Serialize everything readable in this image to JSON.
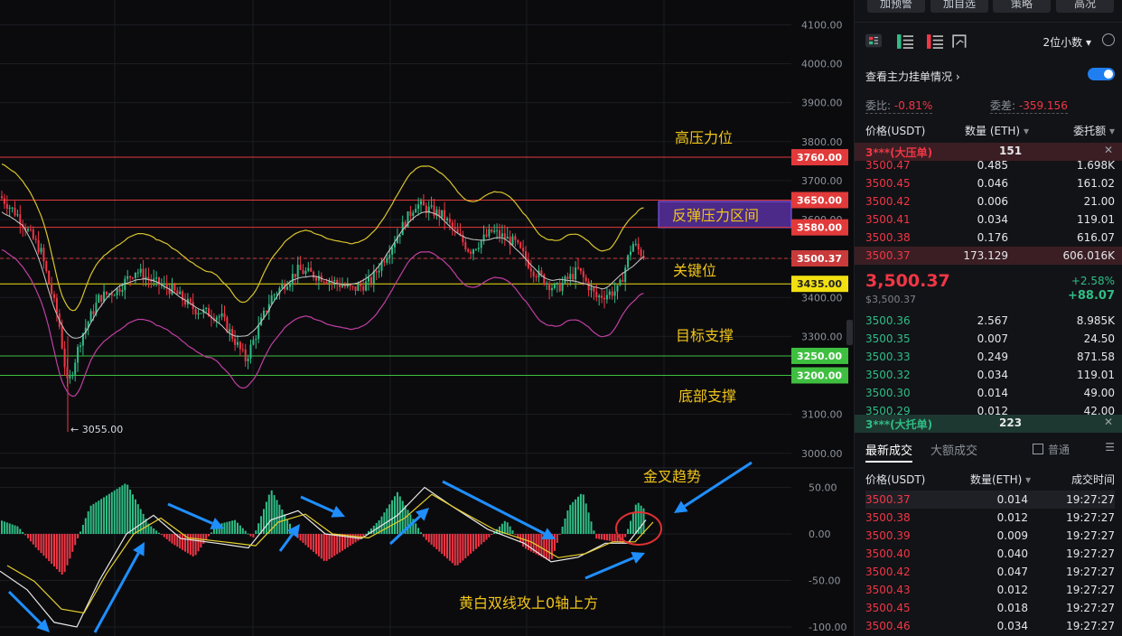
{
  "price_axis": {
    "main_ticks": [
      "4100.00",
      "4000.00",
      "3900.00",
      "3800.00",
      "3700.00",
      "3600.00",
      "3500.00",
      "3400.00",
      "3300.00",
      "3200.00",
      "3100.00",
      "3000.00"
    ],
    "macd_ticks": [
      "50.00",
      "0.00",
      "-50.00",
      "-100.00"
    ]
  },
  "levels": [
    {
      "label": "3760.00",
      "color": "#e23a3a"
    },
    {
      "label": "3650.00",
      "color": "#e23a3a"
    },
    {
      "label": "3580.00",
      "color": "#e23a3a"
    },
    {
      "label": "3500.37",
      "color": "#c93a3a"
    },
    {
      "label": "3435.00",
      "color": "#f2e011"
    },
    {
      "label": "3250.00",
      "color": "#3fbf3f"
    },
    {
      "label": "3200.00",
      "color": "#3fbf3f"
    }
  ],
  "annotations": {
    "high_pressure": "高压力位",
    "rebound_zone": "反弹压力区间",
    "key_level": "关键位",
    "target_support": "目标支撑",
    "bottom_support": "底部支撑",
    "low_marker": "← 3055.00",
    "golden_cross": "金叉趋势",
    "macd_note": "黄白双线攻上0轴上方"
  },
  "colors": {
    "up": "#2fbd85",
    "down": "#f23645",
    "boll_upper": "#d8c32b",
    "boll_mid": "#c9c9c9",
    "boll_lower": "#c03fa0",
    "arrow": "#1f8fff"
  },
  "panel": {
    "top_buttons": [
      "加预警",
      "加自选",
      "策略",
      "高况"
    ],
    "decimal_select": "2位小数",
    "main_order_toggle_label": "查看主力挂单情况",
    "commission_ratio_label": "委比:",
    "commission_ratio_value": "-0.81%",
    "commission_diff_label": "委差:",
    "commission_diff_value": "-359.156",
    "col_price": "价格(USDT)",
    "col_qty": "数量 (ETH)",
    "col_amount": "委托额",
    "big_ask_label": "3***(大压单)",
    "big_ask_qty": "151",
    "asks": [
      {
        "price": "3500.47",
        "qty": "0.485",
        "amt": "1.698K"
      },
      {
        "price": "3500.45",
        "qty": "0.046",
        "amt": "161.02"
      },
      {
        "price": "3500.42",
        "qty": "0.006",
        "amt": "21.00"
      },
      {
        "price": "3500.41",
        "qty": "0.034",
        "amt": "119.01"
      },
      {
        "price": "3500.38",
        "qty": "0.176",
        "amt": "616.07"
      },
      {
        "price": "3500.37",
        "qty": "173.129",
        "amt": "606.016K"
      }
    ],
    "last_price": "3,500.37",
    "last_price_sub": "$3,500.37",
    "change_pct": "+2.58%",
    "change_abs": "+88.07",
    "bids": [
      {
        "price": "3500.36",
        "qty": "2.567",
        "amt": "8.985K"
      },
      {
        "price": "3500.35",
        "qty": "0.007",
        "amt": "24.50"
      },
      {
        "price": "3500.33",
        "qty": "0.249",
        "amt": "871.58"
      },
      {
        "price": "3500.32",
        "qty": "0.034",
        "amt": "119.01"
      },
      {
        "price": "3500.30",
        "qty": "0.014",
        "amt": "49.00"
      },
      {
        "price": "3500.29",
        "qty": "0.012",
        "amt": "42.00"
      }
    ],
    "big_bid_label": "3***(大托单)",
    "big_bid_qty": "223",
    "tab_latest": "最新成交",
    "tab_large": "大额成交",
    "normal_label": "普通",
    "trade_col_price": "价格(USDT)",
    "trade_col_qty": "数量(ETH)",
    "trade_col_time": "成交时间",
    "trades": [
      {
        "price": "3500.37",
        "qty": "0.014",
        "time": "19:27:27"
      },
      {
        "price": "3500.38",
        "qty": "0.012",
        "time": "19:27:27"
      },
      {
        "price": "3500.39",
        "qty": "0.009",
        "time": "19:27:27"
      },
      {
        "price": "3500.40",
        "qty": "0.040",
        "time": "19:27:27"
      },
      {
        "price": "3500.42",
        "qty": "0.047",
        "time": "19:27:27"
      },
      {
        "price": "3500.43",
        "qty": "0.012",
        "time": "19:27:27"
      },
      {
        "price": "3500.45",
        "qty": "0.018",
        "time": "19:27:27"
      },
      {
        "price": "3500.46",
        "qty": "0.034",
        "time": "19:27:27"
      }
    ]
  }
}
